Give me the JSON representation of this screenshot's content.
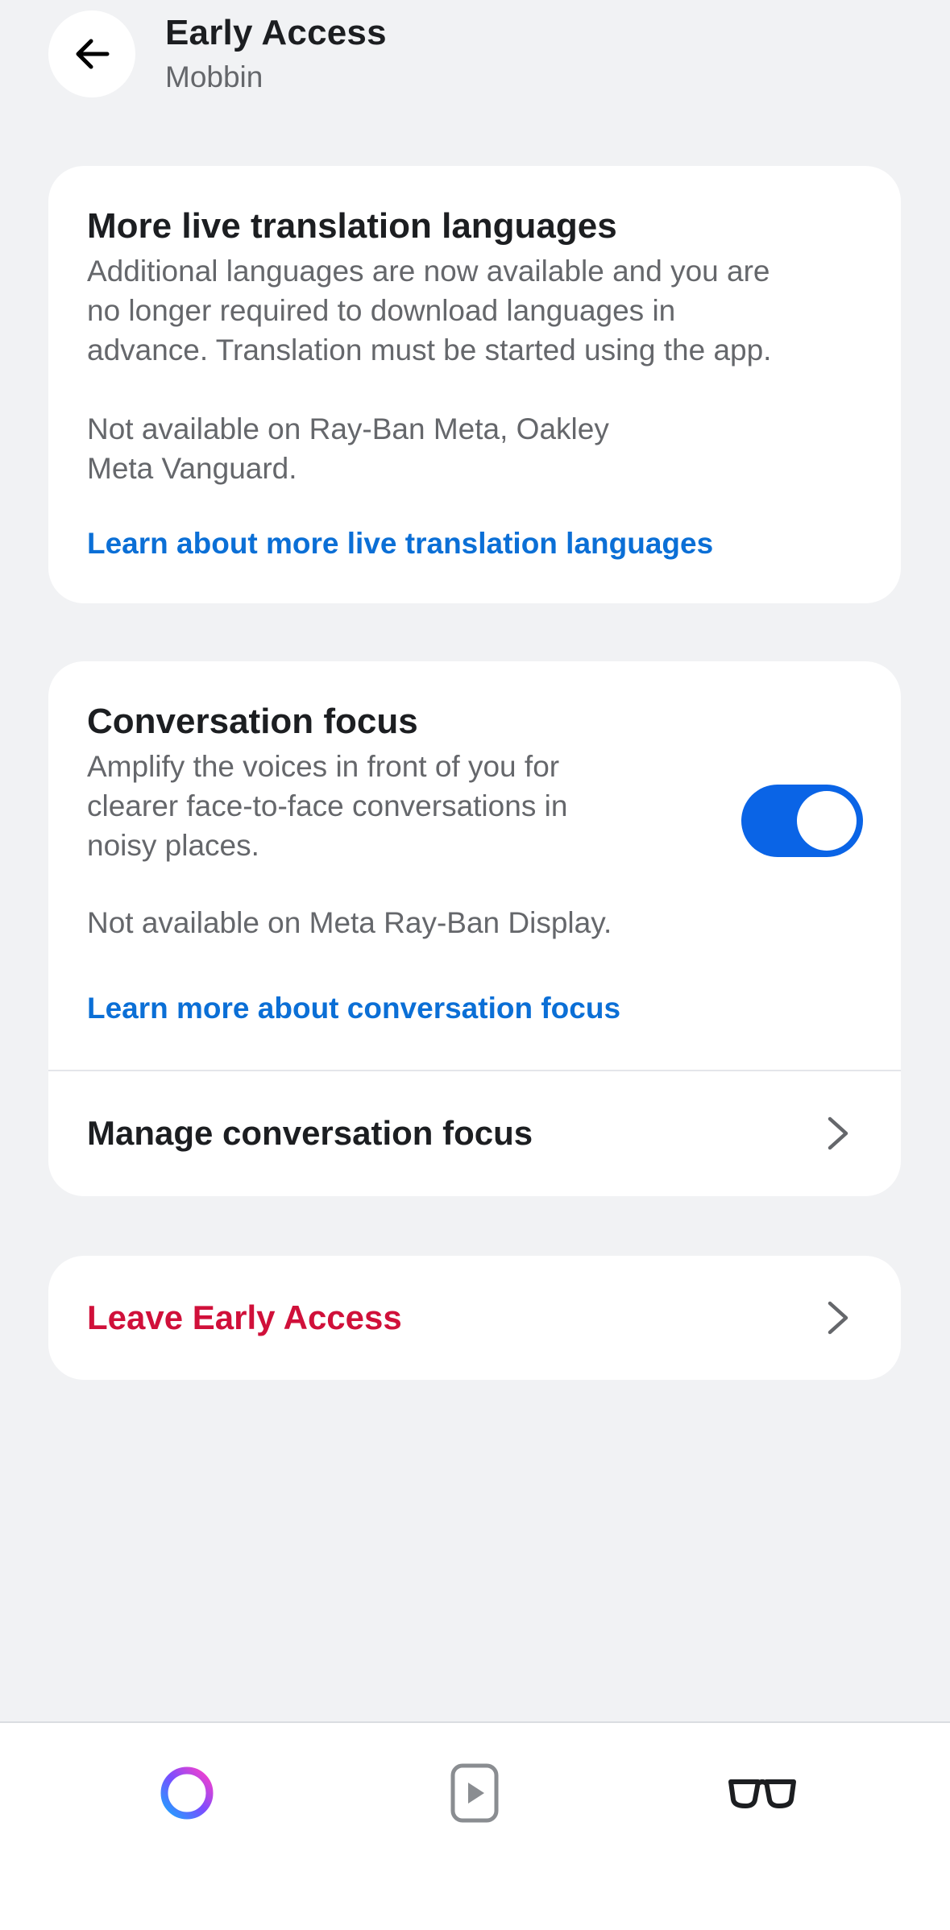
{
  "header": {
    "back_icon": "arrow-left-icon",
    "title": "Early Access",
    "subtitle": "Mobbin"
  },
  "cards": {
    "translation": {
      "title": "More live translation languages",
      "body_lines": [
        "Additional languages are now available and you are",
        "no longer required to download languages in",
        "advance. Translation must be started using the app."
      ],
      "note_lines": [
        "Not available on Ray-Ban Meta, Oakley",
        "Meta Vanguard."
      ],
      "link": "Learn about more live translation languages"
    },
    "conversation": {
      "title": "Conversation focus",
      "body_lines": [
        "Amplify the voices in front of you for",
        "clearer face-to-face conversations in",
        "noisy places."
      ],
      "toggle_on": true,
      "note": "Not available on Meta Ray-Ban Display.",
      "link": "Learn more about conversation focus",
      "manage_label": "Manage conversation focus"
    },
    "leave": {
      "label": "Leave Early Access",
      "color": "#d0103a"
    }
  },
  "bottom_nav": {
    "items": [
      {
        "icon": "meta-ai-ring-icon"
      },
      {
        "icon": "media-play-icon"
      },
      {
        "icon": "glasses-icon"
      }
    ]
  },
  "colors": {
    "background": "#f1f2f4",
    "accent": "#0a64e6",
    "link": "#0b6fd6",
    "danger": "#d0103a"
  }
}
